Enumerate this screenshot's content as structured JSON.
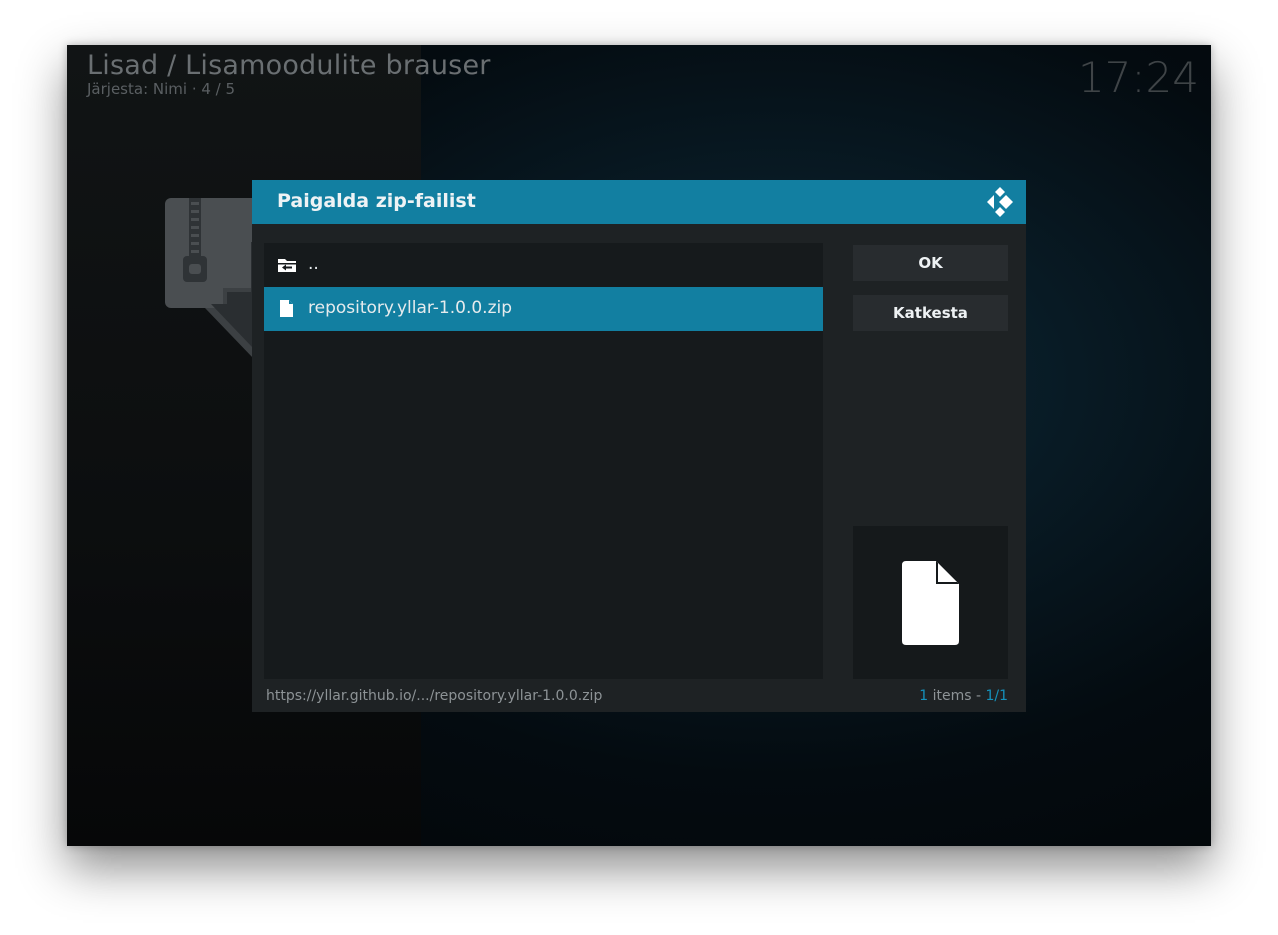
{
  "header": {
    "title": "Lisad / Lisamoodulite brauser",
    "sort_info": "Järjesta: Nimi  ·  4 / 5",
    "clock": "17:24"
  },
  "dialog": {
    "title": "Paigalda zip-failist",
    "logo_icon": "kodi-logo-icon",
    "list": [
      {
        "label": "..",
        "icon": "folder-back-icon",
        "selected": false
      },
      {
        "label": "repository.yllar-1.0.0.zip",
        "icon": "file-icon",
        "selected": true
      }
    ],
    "buttons": {
      "ok": "OK",
      "cancel": "Katkesta"
    },
    "preview_icon": "file-icon",
    "footer": {
      "path": "https://yllar.github.io/.../repository.yllar-1.0.0.zip",
      "items_count": "1",
      "items_label": " items - ",
      "page": "1/1"
    }
  },
  "colors": {
    "accent": "#127fa1",
    "dialog_bg": "#1e2224",
    "list_bg": "#161a1c",
    "button_bg": "#282c2f"
  }
}
